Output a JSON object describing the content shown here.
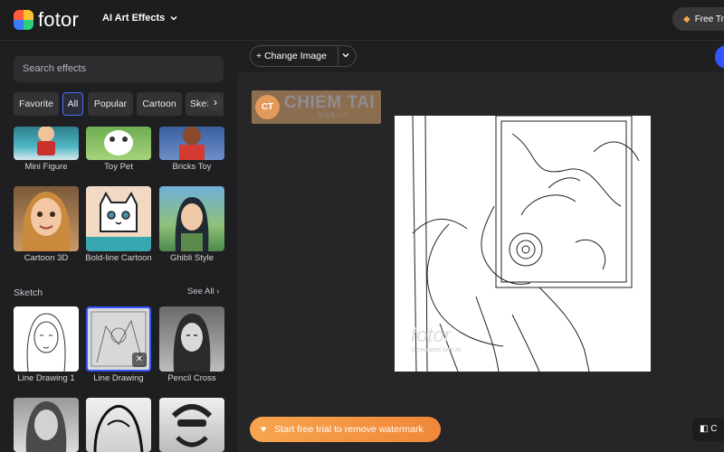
{
  "header": {
    "logo_text": "fotor",
    "menu_label": "AI Art Effects",
    "trial_label": "Free Tr"
  },
  "sidebar": {
    "search_placeholder": "Search effects",
    "categories": [
      "Favorite",
      "All",
      "Popular",
      "Cartoon",
      "Sketch"
    ],
    "active_category": "All",
    "row1": [
      "Mini Figure",
      "Toy Pet",
      "Bricks Toy"
    ],
    "row2": [
      "Cartoon 3D",
      "Bold-line Cartoon",
      "Ghibli Style"
    ],
    "sketch_section": {
      "title": "Sketch",
      "see_all": "See All",
      "items": [
        "Line Drawing 1",
        "Line Drawing",
        "Pencil Cross"
      ]
    }
  },
  "toolbar": {
    "change_image": "Change Image"
  },
  "canvas": {
    "watermark_big": "CHIEM TAI",
    "watermark_small": "MOBILE",
    "watermark_logo": "CT",
    "fotor_watermark": "fotor",
    "generated_watermark": "Generated with AI"
  },
  "footer": {
    "remove_watermark": "Start free trial to remove watermark",
    "compare_label": "C"
  },
  "colors": {
    "accent": "#3355ff",
    "trial_orange": "#f7a54f"
  }
}
